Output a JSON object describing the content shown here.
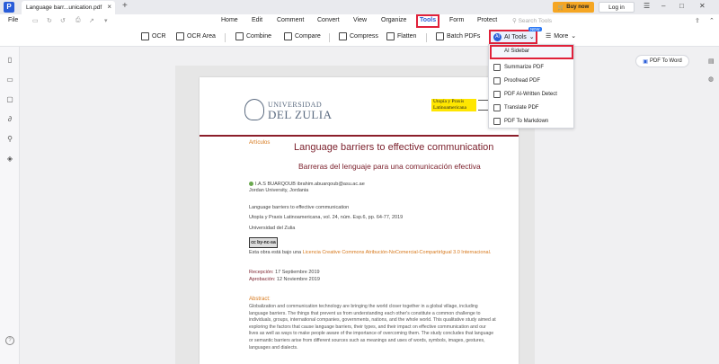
{
  "titlebar": {
    "app_logo": "P",
    "tab_title": "Language barr...unication.pdf",
    "buy_now": "Buy now",
    "login": "Log in"
  },
  "menu": {
    "file": "File",
    "items": [
      "Home",
      "Edit",
      "Comment",
      "Convert",
      "View",
      "Organize",
      "Tools",
      "Form",
      "Protect"
    ],
    "active": "Tools",
    "search_placeholder": "Search Tools"
  },
  "toolbar": {
    "ocr": "OCR",
    "ocr_area": "OCR Area",
    "combine": "Combine",
    "compare": "Compare",
    "compress": "Compress",
    "flatten": "Flatten",
    "batch_pdfs": "Batch PDFs",
    "ai_tools": "AI Tools",
    "ai_badge": "NEW",
    "more": "More"
  },
  "ai_menu": {
    "items": [
      "AI Sidebar",
      "Summarize PDF",
      "Proofread PDF",
      "PDF AI-Written Detect",
      "Translate PDF",
      "PDF To Markdown"
    ]
  },
  "right_panel": {
    "pdf_to_word": "PDF To Word"
  },
  "document": {
    "uni_line1": "UNIVERSIDAD",
    "uni_line2": "DEL ZULIA",
    "journal_badge_line1": "Utopía y Praxis",
    "journal_badge_line2": "Latinoamericana",
    "section": "Artículos",
    "title_en": "Language barriers to effective communication",
    "title_es": "Barreras del lenguaje para una comunicación efectiva",
    "author_name": "I.A.S BUARQOUB",
    "author_email": "ibrahim.abuarqoub@asu.ac.ae",
    "author_affiliation": "Jordan University, Jordania",
    "meta_title": "Language barriers to effective communication",
    "meta_journal": "Utopía y Praxis Latinoamericana, vol. 24, núm. Esp.6, pp. 64-77, 2019",
    "meta_publisher": "Universidad del Zulia",
    "cc_badge": "cc by-nc-sa",
    "license_prefix": "Esta obra está bajo una ",
    "license_link": "Licencia Creative Commons Atribución-NoComercial-CompartirIgual 3.0 Internacional.",
    "received_label": "Recepción:",
    "received_date": "17 Septiembre 2019",
    "approved_label": "Aprobación:",
    "approved_date": "12 Noviembre 2019",
    "abstract_label": "Abstract:",
    "abstract_text": "Globalization and communication technology are bringing the world closer together in a global village, including language barriers. The things that prevent us from understanding each other's constitute a common challenge to individuals, groups, international companies, governments, nations, and the whole world. This qualitative study aimed at exploring the factors that cause language barriers, their types, and their impact on effective communication and our lives as well as ways to make people aware of the importance of overcoming them. The study concludes that language or semantic barriers arise from different sources such as meanings and uses of words, symbols, images, gestures, languages and dialects."
  }
}
